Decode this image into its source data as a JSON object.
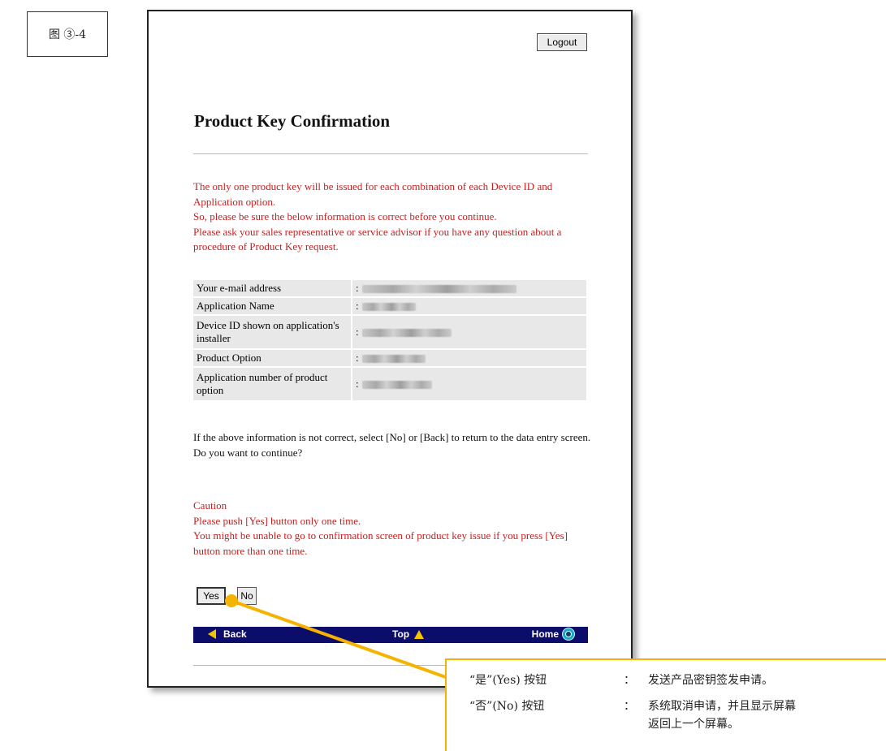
{
  "figure_label": "图 ③-4",
  "header": {
    "logout_label": "Logout"
  },
  "page_title": "Product Key Confirmation",
  "warning_lines": [
    "The only one product key will be issued for each combination of each Device ID and Application option.",
    "So, please be sure the below information is correct before you continue.",
    "Please ask your sales representative or service advisor if you have any question about a procedure of Product Key request."
  ],
  "info_rows": [
    {
      "label": "Your e-mail address",
      "colon": ":"
    },
    {
      "label": "Application Name",
      "colon": ":"
    },
    {
      "label": "Device ID shown on application's installer",
      "colon": ":"
    },
    {
      "label": "Product Option",
      "colon": ":"
    },
    {
      "label": "Application number of product option",
      "colon": ":"
    }
  ],
  "confirm_lines": [
    "If the above information is not correct, select [No] or [Back] to return to the data entry screen.",
    "Do you want to continue?"
  ],
  "caution_lines": [
    "Caution",
    "Please push [Yes] button only one time.",
    "You might be unable to go to confirmation screen of product key issue if you press [Yes] button more than one time."
  ],
  "buttons": {
    "yes": "Yes",
    "no": "No"
  },
  "nav": {
    "back": "Back",
    "top": "Top",
    "home": "Home"
  },
  "callout": {
    "yes_label": "“是”(Yes) 按钮",
    "yes_colon": "：",
    "yes_desc": "发送产品密钥签发申请。",
    "no_label": "“否”(No) 按钮",
    "no_colon": "：",
    "no_desc": "系统取消申请，并且显示屏幕返回上一个屏幕。"
  },
  "colors": {
    "warning_red": "#c81f1f",
    "nav_bar": "#0c0c6b",
    "callout_accent": "#f5b300"
  }
}
